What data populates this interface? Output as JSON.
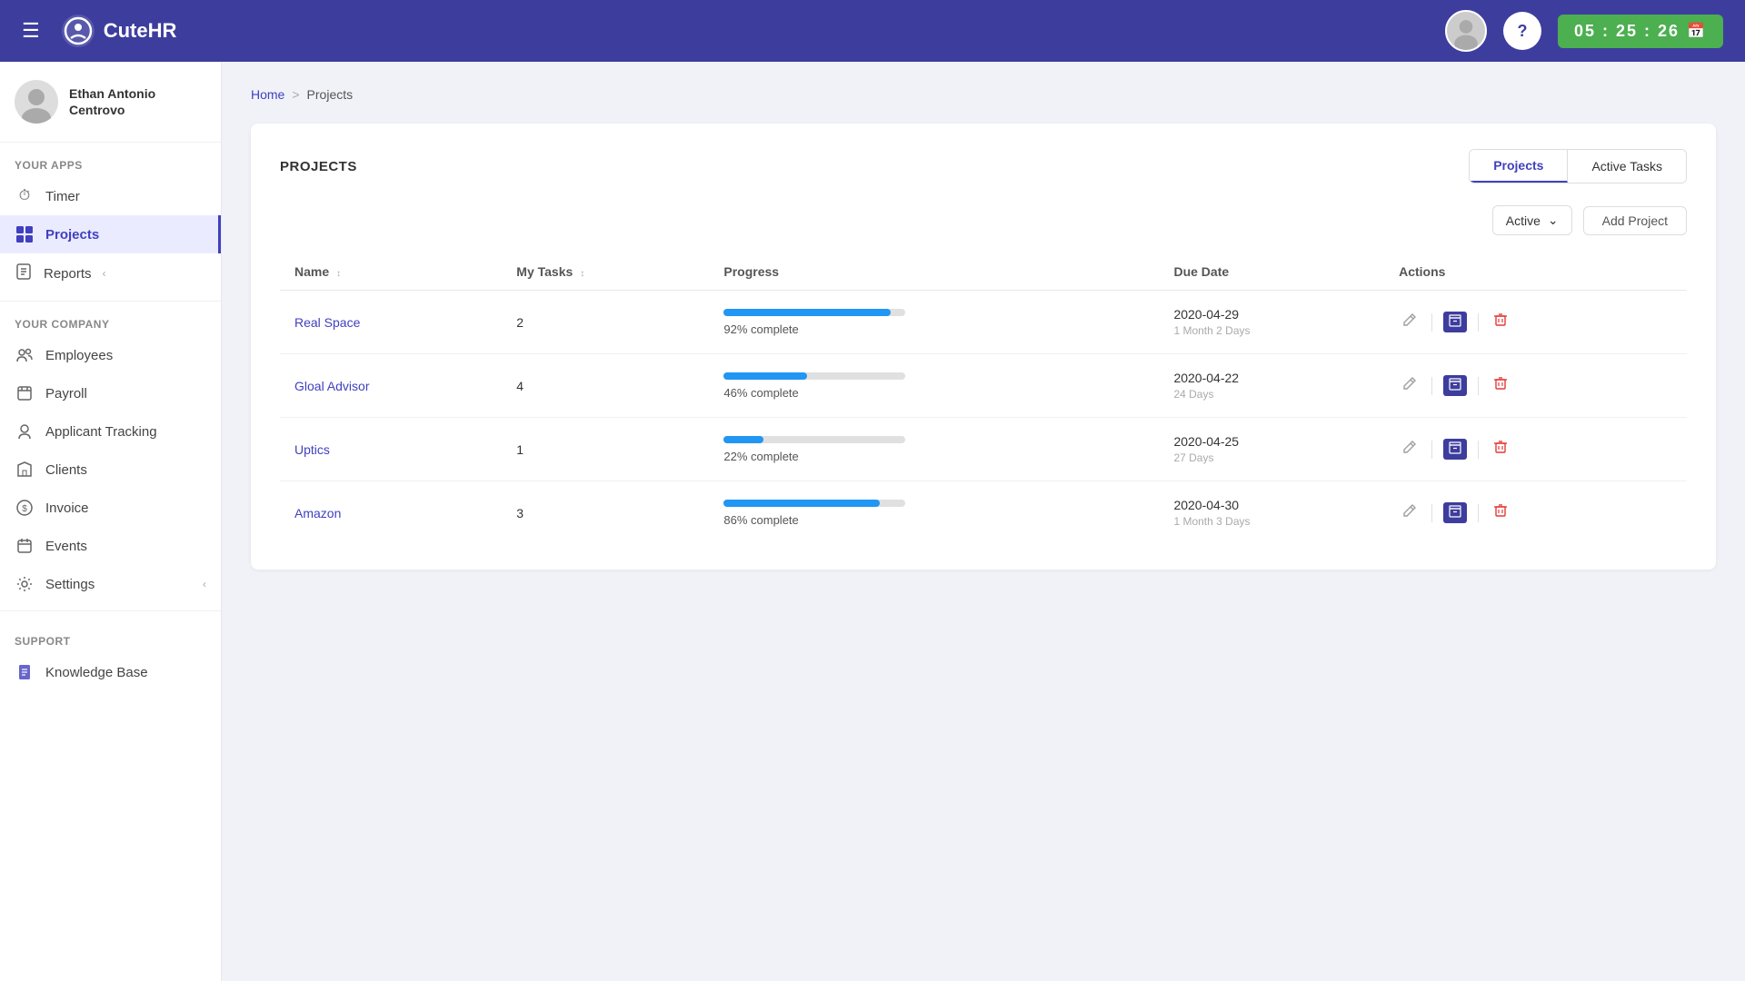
{
  "topnav": {
    "logo_text": "CuteHR",
    "timer_text": "05 : 25 : 26"
  },
  "sidebar": {
    "user": {
      "name": "Ethan Antonio\nCentrovo"
    },
    "your_apps_label": "Your Apps",
    "apps": [
      {
        "id": "timer",
        "label": "Timer",
        "icon": "⏱"
      },
      {
        "id": "projects",
        "label": "Projects",
        "icon": "▦",
        "active": true
      }
    ],
    "reports_label": "Reports",
    "your_company_label": "Your Company",
    "company_items": [
      {
        "id": "employees",
        "label": "Employees",
        "icon": "👥"
      },
      {
        "id": "payroll",
        "label": "Payroll",
        "icon": "📋"
      },
      {
        "id": "applicant-tracking",
        "label": "Applicant Tracking",
        "icon": "👤"
      },
      {
        "id": "clients",
        "label": "Clients",
        "icon": "🏢"
      },
      {
        "id": "invoice",
        "label": "Invoice",
        "icon": "💲"
      },
      {
        "id": "events",
        "label": "Events",
        "icon": "📅"
      },
      {
        "id": "settings",
        "label": "Settings",
        "icon": "⚙"
      }
    ],
    "support_label": "Support",
    "support_items": [
      {
        "id": "knowledge-base",
        "label": "Knowledge Base",
        "icon": "📖"
      }
    ]
  },
  "breadcrumb": {
    "home": "Home",
    "current": "Projects"
  },
  "card": {
    "title": "PROJECTS",
    "tab_projects": "Projects",
    "tab_active_tasks": "Active Tasks",
    "status_label": "Active",
    "add_project_label": "Add Project",
    "table": {
      "columns": [
        "Name",
        "My Tasks",
        "Progress",
        "Due Date",
        "Actions"
      ],
      "rows": [
        {
          "name": "Real Space",
          "my_tasks": "2",
          "progress_pct": 92,
          "progress_label": "92% complete",
          "due_date": "2020-04-29",
          "due_date_sub": "1 Month 2 Days"
        },
        {
          "name": "Gloal Advisor",
          "my_tasks": "4",
          "progress_pct": 46,
          "progress_label": "46% complete",
          "due_date": "2020-04-22",
          "due_date_sub": "24 Days"
        },
        {
          "name": "Uptics",
          "my_tasks": "1",
          "progress_pct": 22,
          "progress_label": "22% complete",
          "due_date": "2020-04-25",
          "due_date_sub": "27 Days"
        },
        {
          "name": "Amazon",
          "my_tasks": "3",
          "progress_pct": 86,
          "progress_label": "86% complete",
          "due_date": "2020-04-30",
          "due_date_sub": "1 Month 3 Days"
        }
      ]
    }
  }
}
